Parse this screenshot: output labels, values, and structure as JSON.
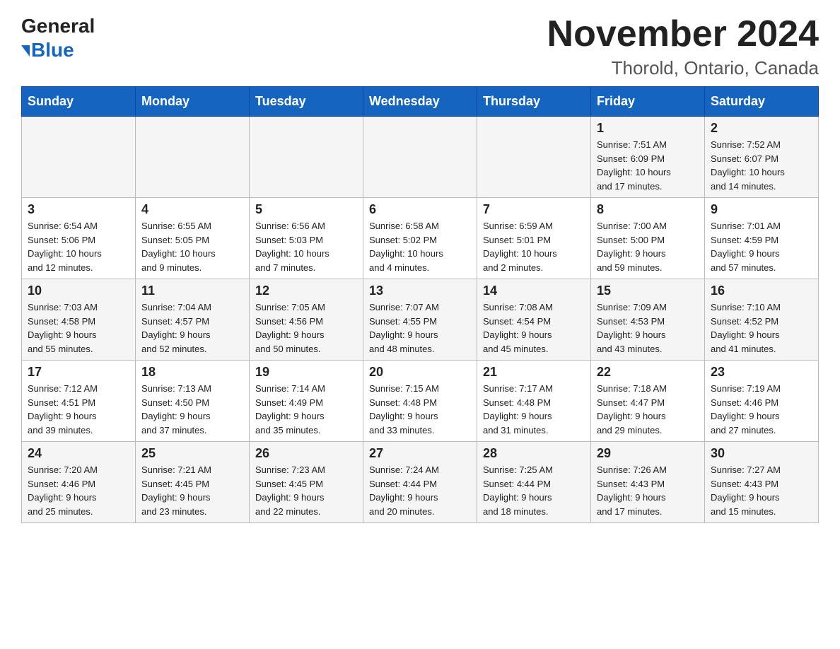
{
  "header": {
    "logo_general": "General",
    "logo_blue": "Blue",
    "month_title": "November 2024",
    "location": "Thorold, Ontario, Canada"
  },
  "days_of_week": [
    "Sunday",
    "Monday",
    "Tuesday",
    "Wednesday",
    "Thursday",
    "Friday",
    "Saturday"
  ],
  "weeks": [
    [
      {
        "day": "",
        "info": ""
      },
      {
        "day": "",
        "info": ""
      },
      {
        "day": "",
        "info": ""
      },
      {
        "day": "",
        "info": ""
      },
      {
        "day": "",
        "info": ""
      },
      {
        "day": "1",
        "info": "Sunrise: 7:51 AM\nSunset: 6:09 PM\nDaylight: 10 hours\nand 17 minutes."
      },
      {
        "day": "2",
        "info": "Sunrise: 7:52 AM\nSunset: 6:07 PM\nDaylight: 10 hours\nand 14 minutes."
      }
    ],
    [
      {
        "day": "3",
        "info": "Sunrise: 6:54 AM\nSunset: 5:06 PM\nDaylight: 10 hours\nand 12 minutes."
      },
      {
        "day": "4",
        "info": "Sunrise: 6:55 AM\nSunset: 5:05 PM\nDaylight: 10 hours\nand 9 minutes."
      },
      {
        "day": "5",
        "info": "Sunrise: 6:56 AM\nSunset: 5:03 PM\nDaylight: 10 hours\nand 7 minutes."
      },
      {
        "day": "6",
        "info": "Sunrise: 6:58 AM\nSunset: 5:02 PM\nDaylight: 10 hours\nand 4 minutes."
      },
      {
        "day": "7",
        "info": "Sunrise: 6:59 AM\nSunset: 5:01 PM\nDaylight: 10 hours\nand 2 minutes."
      },
      {
        "day": "8",
        "info": "Sunrise: 7:00 AM\nSunset: 5:00 PM\nDaylight: 9 hours\nand 59 minutes."
      },
      {
        "day": "9",
        "info": "Sunrise: 7:01 AM\nSunset: 4:59 PM\nDaylight: 9 hours\nand 57 minutes."
      }
    ],
    [
      {
        "day": "10",
        "info": "Sunrise: 7:03 AM\nSunset: 4:58 PM\nDaylight: 9 hours\nand 55 minutes."
      },
      {
        "day": "11",
        "info": "Sunrise: 7:04 AM\nSunset: 4:57 PM\nDaylight: 9 hours\nand 52 minutes."
      },
      {
        "day": "12",
        "info": "Sunrise: 7:05 AM\nSunset: 4:56 PM\nDaylight: 9 hours\nand 50 minutes."
      },
      {
        "day": "13",
        "info": "Sunrise: 7:07 AM\nSunset: 4:55 PM\nDaylight: 9 hours\nand 48 minutes."
      },
      {
        "day": "14",
        "info": "Sunrise: 7:08 AM\nSunset: 4:54 PM\nDaylight: 9 hours\nand 45 minutes."
      },
      {
        "day": "15",
        "info": "Sunrise: 7:09 AM\nSunset: 4:53 PM\nDaylight: 9 hours\nand 43 minutes."
      },
      {
        "day": "16",
        "info": "Sunrise: 7:10 AM\nSunset: 4:52 PM\nDaylight: 9 hours\nand 41 minutes."
      }
    ],
    [
      {
        "day": "17",
        "info": "Sunrise: 7:12 AM\nSunset: 4:51 PM\nDaylight: 9 hours\nand 39 minutes."
      },
      {
        "day": "18",
        "info": "Sunrise: 7:13 AM\nSunset: 4:50 PM\nDaylight: 9 hours\nand 37 minutes."
      },
      {
        "day": "19",
        "info": "Sunrise: 7:14 AM\nSunset: 4:49 PM\nDaylight: 9 hours\nand 35 minutes."
      },
      {
        "day": "20",
        "info": "Sunrise: 7:15 AM\nSunset: 4:48 PM\nDaylight: 9 hours\nand 33 minutes."
      },
      {
        "day": "21",
        "info": "Sunrise: 7:17 AM\nSunset: 4:48 PM\nDaylight: 9 hours\nand 31 minutes."
      },
      {
        "day": "22",
        "info": "Sunrise: 7:18 AM\nSunset: 4:47 PM\nDaylight: 9 hours\nand 29 minutes."
      },
      {
        "day": "23",
        "info": "Sunrise: 7:19 AM\nSunset: 4:46 PM\nDaylight: 9 hours\nand 27 minutes."
      }
    ],
    [
      {
        "day": "24",
        "info": "Sunrise: 7:20 AM\nSunset: 4:46 PM\nDaylight: 9 hours\nand 25 minutes."
      },
      {
        "day": "25",
        "info": "Sunrise: 7:21 AM\nSunset: 4:45 PM\nDaylight: 9 hours\nand 23 minutes."
      },
      {
        "day": "26",
        "info": "Sunrise: 7:23 AM\nSunset: 4:45 PM\nDaylight: 9 hours\nand 22 minutes."
      },
      {
        "day": "27",
        "info": "Sunrise: 7:24 AM\nSunset: 4:44 PM\nDaylight: 9 hours\nand 20 minutes."
      },
      {
        "day": "28",
        "info": "Sunrise: 7:25 AM\nSunset: 4:44 PM\nDaylight: 9 hours\nand 18 minutes."
      },
      {
        "day": "29",
        "info": "Sunrise: 7:26 AM\nSunset: 4:43 PM\nDaylight: 9 hours\nand 17 minutes."
      },
      {
        "day": "30",
        "info": "Sunrise: 7:27 AM\nSunset: 4:43 PM\nDaylight: 9 hours\nand 15 minutes."
      }
    ]
  ]
}
